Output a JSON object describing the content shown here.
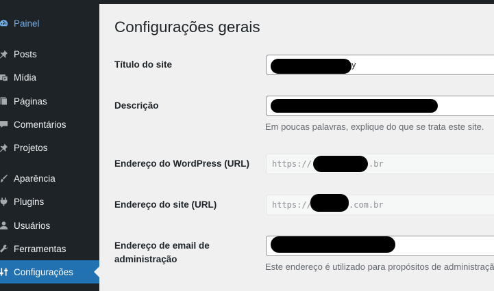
{
  "sidebar": {
    "items": [
      {
        "label": "Painel",
        "icon": "dashboard-icon"
      },
      {
        "label": "Posts",
        "icon": "pin-icon"
      },
      {
        "label": "Mídia",
        "icon": "media-icon"
      },
      {
        "label": "Páginas",
        "icon": "page-icon"
      },
      {
        "label": "Comentários",
        "icon": "comment-icon"
      },
      {
        "label": "Projetos",
        "icon": "pin-icon"
      },
      {
        "label": "Aparência",
        "icon": "brush-icon"
      },
      {
        "label": "Plugins",
        "icon": "plugin-icon"
      },
      {
        "label": "Usuários",
        "icon": "users-icon"
      },
      {
        "label": "Ferramentas",
        "icon": "wrench-icon"
      },
      {
        "label": "Configurações",
        "icon": "settings-icon",
        "active": true
      }
    ]
  },
  "page": {
    "title": "Configurações gerais"
  },
  "form": {
    "site_title": {
      "label": "Título do site",
      "value": "y"
    },
    "description": {
      "label": "Descrição",
      "value": "",
      "hint": "Em poucas palavras, explique do que se trata este site."
    },
    "wp_url": {
      "label": "Endereço do WordPress (URL)",
      "prefix": "https://",
      "suffix": ".br"
    },
    "site_url": {
      "label": "Endereço do site (URL)",
      "prefix": "https://",
      "suffix": ".com.br"
    },
    "admin_email": {
      "label_line1": "Endereço de email de",
      "label_line2": "administração",
      "hint": "Este endereço é utilizado para propósitos de administração."
    }
  },
  "colors": {
    "sidebar_bg": "#1d2327",
    "active_bg": "#2271b1",
    "link_blue": "#72aee6",
    "page_bg": "#f0f0f1"
  }
}
